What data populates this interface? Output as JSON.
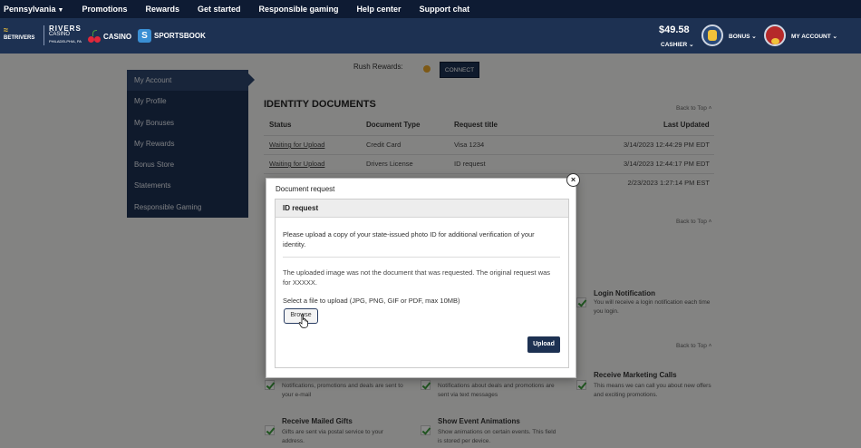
{
  "topnav": {
    "state": "Pennsylvania",
    "items": [
      "Promotions",
      "Rewards",
      "Get started",
      "Responsible gaming",
      "Help center",
      "Support chat"
    ]
  },
  "header": {
    "logo_betrivers": "BETRIVERS",
    "logo_rivers": "RIVERS",
    "logo_rivers_sub": "CASINO",
    "logo_rivers_sub2": "PHILADELPHIA, PA",
    "casino": "CASINO",
    "sportsbook": "SPORTSBOOK",
    "balance": "$49.58",
    "cashier": "CASHIER",
    "bonus": "BONUS",
    "account": "MY ACCOUNT"
  },
  "sidemenu": [
    "My Account",
    "My Profile",
    "My Bonuses",
    "My Rewards",
    "Bonus Store",
    "Statements",
    "Responsible Gaming"
  ],
  "rush": {
    "label": "Rush Rewards:",
    "connect": "CONNECT"
  },
  "identity": {
    "title": "IDENTITY DOCUMENTS",
    "back_to_top": "Back to Top",
    "columns": [
      "Status",
      "Document Type",
      "Request title",
      "Last Updated"
    ],
    "rows": [
      {
        "status": "Waiting for Upload",
        "type": "Credit Card",
        "title": "Visa 1234",
        "updated": "3/14/2023 12:44:29 PM EDT"
      },
      {
        "status": "Waiting for Upload",
        "type": "Drivers License",
        "title": "ID request",
        "updated": "3/14/2023 12:44:17 PM EDT"
      },
      {
        "status": "",
        "type": "",
        "title": "",
        "updated": "2/23/2023 1:27:14 PM EST"
      }
    ]
  },
  "notifications": {
    "login_title": "Login Notification",
    "login_desc": "You will receive a login notification each time you login.",
    "email_desc": "Notifications, promotions and deals are sent to your e-mail",
    "text_desc": "Notifications about deals and promotions are sent via text messages",
    "calls_title": "Receive Marketing Calls",
    "calls_desc": "This means we can call you about new offers and exciting promotions.",
    "mail_title": "Receive Mailed Gifts",
    "mail_desc": "Gifts are sent via postal service to your address.",
    "anim_title": "Show Event Animations",
    "anim_desc": "Show animations on certain events. This field is stored per device."
  },
  "modal": {
    "title": "Document request",
    "subtitle": "ID request",
    "instructions": "Please upload a copy of your state-issued photo ID for additional verification of your identity.",
    "notice": "The uploaded image was not the document that was requested. The original request was for XXXXX.",
    "file_prompt": "Select a file to upload (JPG, PNG, GIF or PDF, max 10MB)",
    "browse": "Browse",
    "upload": "Upload",
    "close": "×"
  },
  "colors": {
    "navy": "#1d3152",
    "dark_navy": "#0e1b33",
    "check_green": "#3c9b3c",
    "rush_gold": "#e7a52a"
  }
}
